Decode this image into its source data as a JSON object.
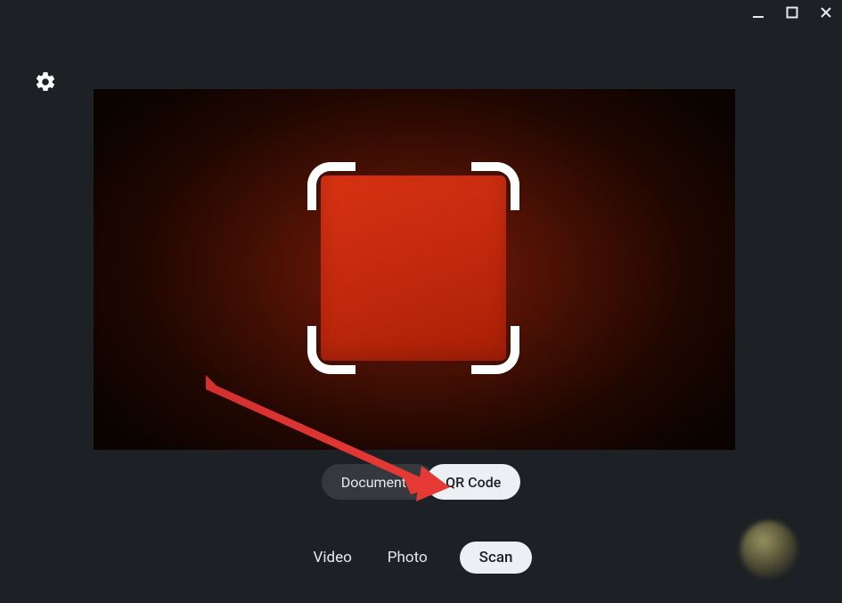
{
  "window_controls": {
    "minimize_title": "Minimize",
    "maximize_title": "Maximize",
    "close_title": "Close"
  },
  "settings": {
    "title": "Settings"
  },
  "sub_modes": {
    "document": "Document",
    "qr_code": "QR Code"
  },
  "modes": {
    "video": "Video",
    "photo": "Photo",
    "scan": "Scan"
  },
  "shutter": {
    "title": "Capture"
  }
}
